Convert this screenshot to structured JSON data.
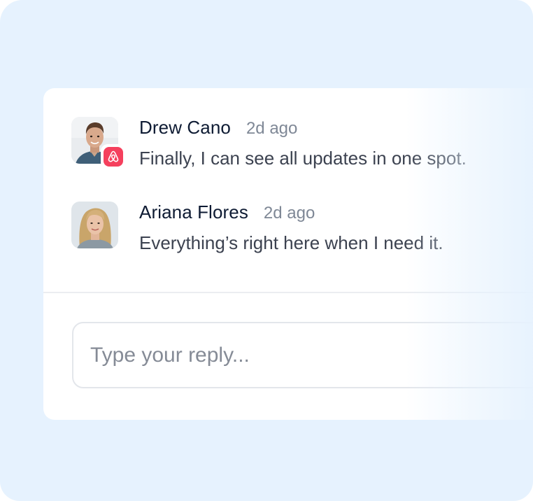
{
  "comments": [
    {
      "author": "Drew Cano",
      "time": "2d ago",
      "message": "Finally, I can see all updates in one spot.",
      "avatar": "man-portrait-photo",
      "badge_icon": "airbnb-logo-icon",
      "badge_color": "#f5405d"
    },
    {
      "author": "Ariana Flores",
      "time": "2d ago",
      "message": "Everything’s right here when I need it.",
      "avatar": "woman-portrait-photo"
    }
  ],
  "reply": {
    "placeholder": "Type your reply...",
    "value": ""
  },
  "colors": {
    "background": "#e6f2fe",
    "card": "#ffffff",
    "author": "#0e1b33",
    "timestamp": "#7f8896",
    "message": "#3c4250"
  }
}
